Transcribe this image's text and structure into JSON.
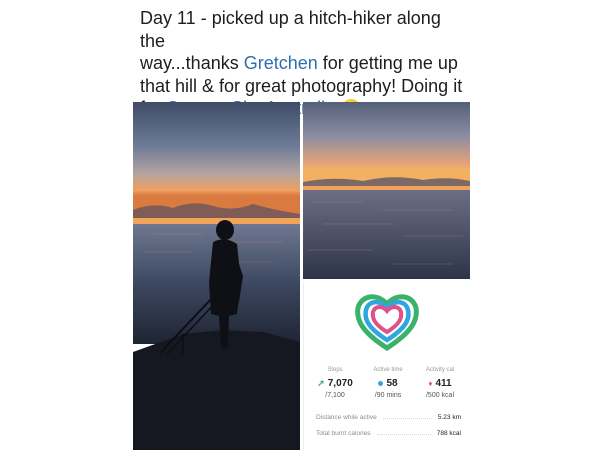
{
  "post": {
    "line1": "Day 11 - picked up a hitch-hiker along the",
    "line2_pre": "way...thanks ",
    "mention1": "Gretchen",
    "line2_post": " for getting me up",
    "line3": "that hill & for great photography! Doing it",
    "line4_pre": "for ",
    "mention2": "Orange Sky Australia",
    "emoji": "smiling-face-emoji"
  },
  "stats": {
    "steps": {
      "label": "Steps",
      "value": "7,070",
      "goal": "/7,100",
      "color": "#3ab26a"
    },
    "active_time": {
      "label": "Active time",
      "value": "58",
      "goal": "/90 mins",
      "color": "#2ea7df"
    },
    "activity_cal": {
      "label": "Activity cal",
      "value": "411",
      "goal": "/500 kcal",
      "color": "#e0508a"
    },
    "distance": {
      "label": "Distance while active",
      "value": "5.23 km"
    },
    "calories": {
      "label": "Total burnt calories",
      "value": "788 kcal"
    }
  },
  "colors": {
    "mention": "#2f6fb1",
    "ring_steps": "#3ab26a",
    "ring_time": "#2ea7df",
    "ring_cal": "#e0508a"
  }
}
